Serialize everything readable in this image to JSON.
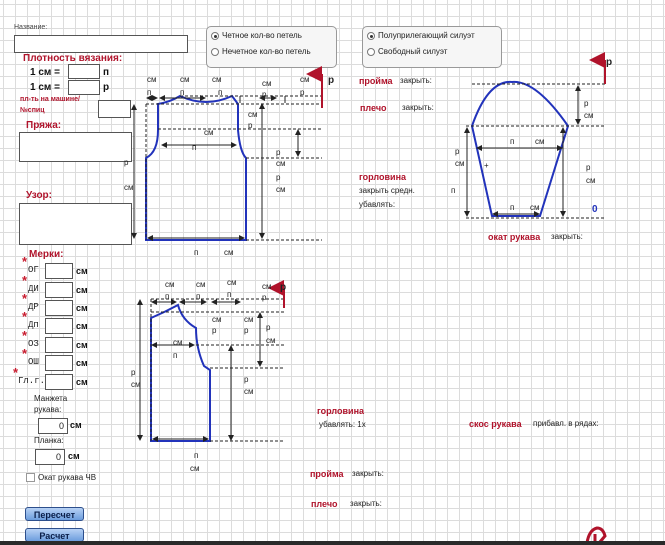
{
  "form": {
    "name_label": "Название:",
    "density_title": "Плотность вязания:",
    "cm1": "1 см =",
    "unit_p": "п",
    "unit_r": "р",
    "machine_label": "пл-ть на машине/",
    "needles_label": "№спиц",
    "yarn_title": "Пряжа:",
    "pattern_title": "Узор:",
    "measures_title": "Мерки:",
    "measures": [
      "ОГ",
      "ДИ",
      "ДР",
      "Дп",
      "ОЗ",
      "ОШ",
      "Гл.г."
    ],
    "unit_cm": "см",
    "cuff_label_1": "Манжета",
    "cuff_label_2": "рукава:",
    "cuff_value": "0",
    "placket_label": "Планка:",
    "placket_value": "0",
    "cap_checkbox_label": "Окат рукава ЧВ",
    "recalc_button": "Пересчет",
    "calc_button": "Расчет"
  },
  "options": {
    "even_loops": "Четное кол-во петель",
    "odd_loops": "Нечетное кол-во петель",
    "semi_fitted": "Полуприлегающий силуэт",
    "loose": "Свободный силуэт"
  },
  "diagram": {
    "cm": "см",
    "p": "п",
    "r": "р",
    "armhole": "пройма",
    "close": "закрыть:",
    "shoulder": "плечо",
    "neckline": "горловина",
    "close_middle": "закрыть средн.",
    "decrease": "убавлять:",
    "decrease_1x": "убавлять: 1х",
    "sleeve_cap": "окат рукава",
    "sleeve_bevel": "скос рукава",
    "add_in_rows": "прибавл. в рядах:",
    "plus": "+",
    "zero": "0"
  },
  "colors": {
    "accent_red": "#b0132b",
    "pattern_blue": "#2233bb",
    "button_blue": "#6c9ddd"
  }
}
